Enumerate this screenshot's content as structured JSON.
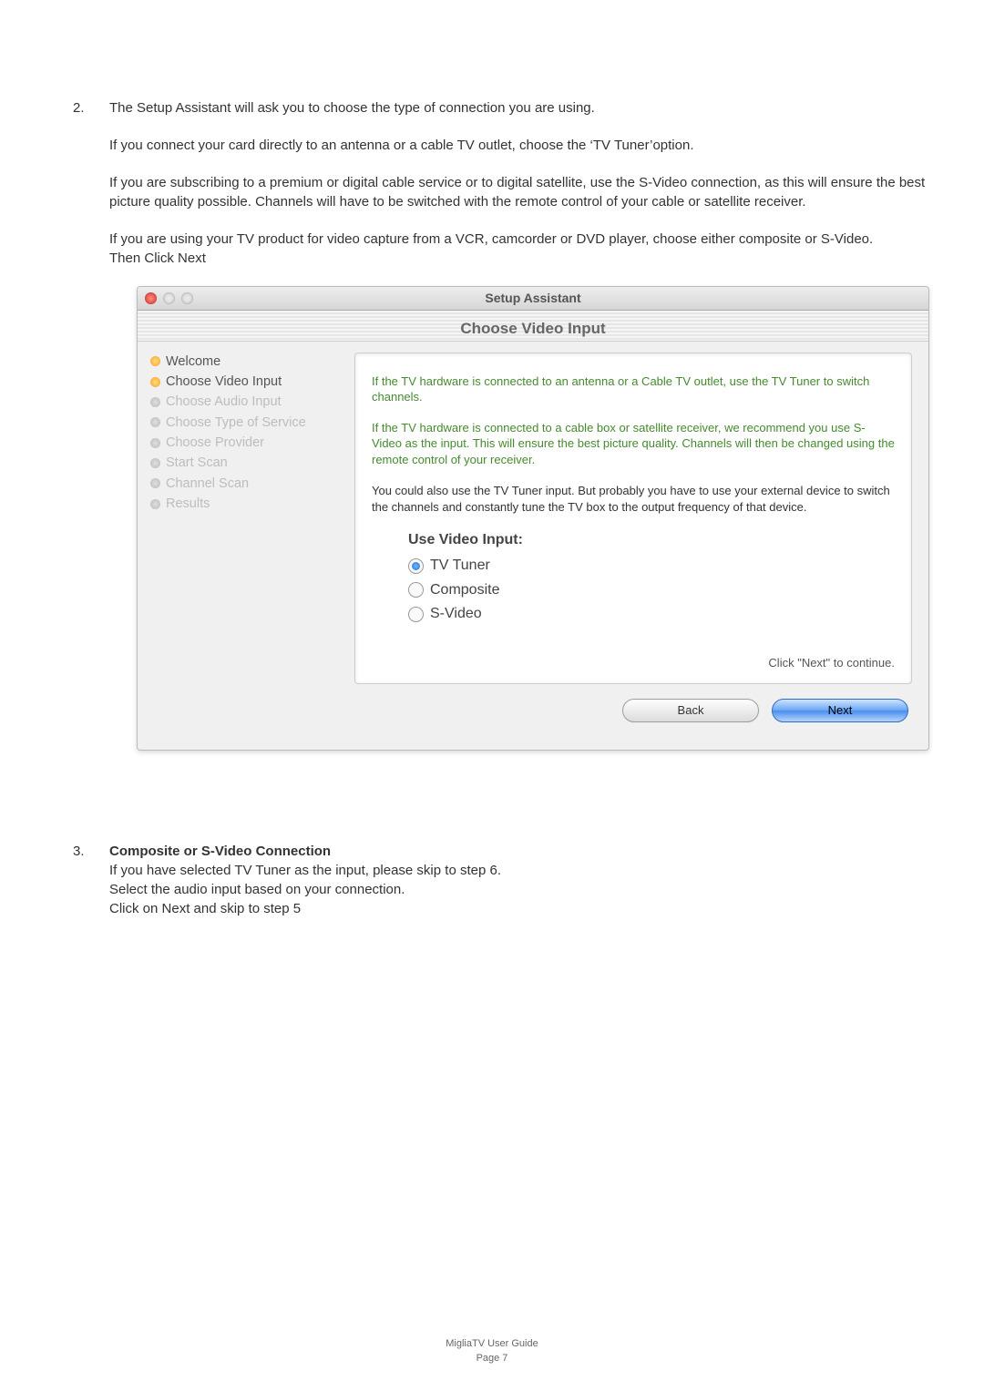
{
  "step2": {
    "num": "2.",
    "p1": "The Setup Assistant will ask you to choose the type of connection you are using.",
    "p2": "If you connect your card directly to an antenna or a cable TV outlet, choose the ‘TV Tuner’option.",
    "p3": "If you are subscribing to a premium or digital cable service or to digital satellite, use the S-Video connection, as this will ensure the best picture quality possible. Channels will have to be switched with the remote control of your cable or satellite receiver.",
    "p4": "If you are using your TV product  for video capture from a VCR, camcorder or DVD player, choose either composite or S-Video.",
    "p5": "Then Click Next"
  },
  "dialog": {
    "title": "Setup Assistant",
    "heading": "Choose Video Input",
    "sidebar": {
      "items": [
        {
          "label": "Welcome",
          "state": "done"
        },
        {
          "label": "Choose Video Input",
          "state": "current"
        },
        {
          "label": "Choose Audio Input",
          "state": "future"
        },
        {
          "label": "Choose Type of Service",
          "state": "future"
        },
        {
          "label": "Choose Provider",
          "state": "future"
        },
        {
          "label": "Start Scan",
          "state": "future"
        },
        {
          "label": "Channel Scan",
          "state": "future"
        },
        {
          "label": "Results",
          "state": "future"
        }
      ]
    },
    "well": {
      "g1": "If the TV hardware is connected to an antenna or a Cable TV outlet, use the TV Tuner to switch channels.",
      "g2": "If the TV hardware is connected to a cable box or satellite receiver, we recommend you use S-Video as the input. This will ensure the best picture quality. Channels will then be changed using the remote control of your receiver.",
      "p1": "You could also use the TV Tuner input. But probably you have to use your external device to switch the channels and constantly tune the TV box to the output frequency of that device.",
      "inputs_header": "Use Video Input:",
      "options": {
        "tv": "TV Tuner",
        "comp": "Composite",
        "sv": "S-Video"
      },
      "continue": "Click \"Next\" to continue."
    },
    "buttons": {
      "back": "Back",
      "next": "Next"
    }
  },
  "step3": {
    "num": "3.",
    "title": "Composite or S-Video Connection",
    "p1": "If you have selected TV Tuner as the input, please skip to step 6.",
    "p2": "Select the audio input based on your connection.",
    "p3": "Click on Next and skip to step 5"
  },
  "footer": {
    "l1": "MigliaTV User Guide",
    "l2": "Page 7"
  }
}
